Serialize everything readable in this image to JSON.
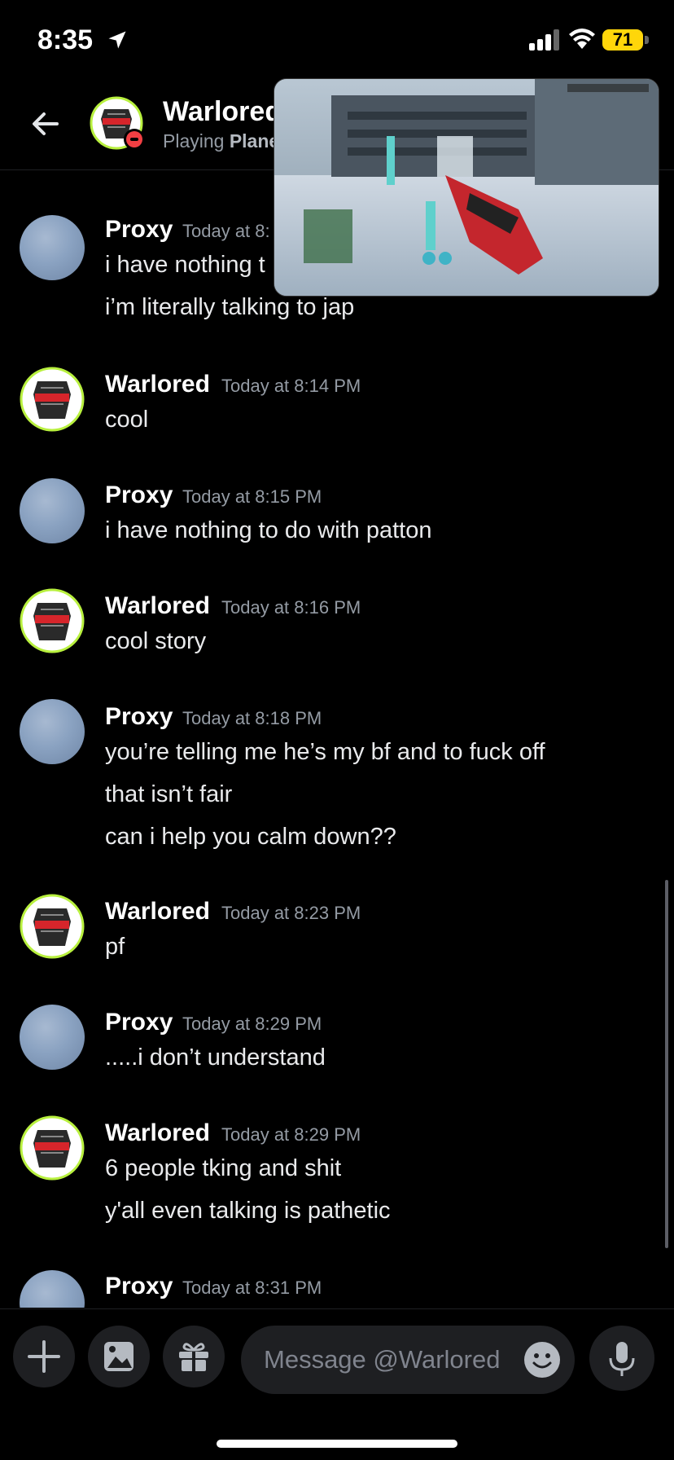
{
  "status_bar": {
    "time": "8:35",
    "battery": "71"
  },
  "header": {
    "name": "Warlored",
    "status_prefix": "Playing",
    "status_game": "Plane"
  },
  "messages": [
    {
      "user": "Proxy",
      "time": "Today at 8:",
      "lines": [
        "i have nothing t",
        "i’m literally talking to jap"
      ]
    },
    {
      "user": "Warlored",
      "time": "Today at 8:14 PM",
      "lines": [
        "cool"
      ]
    },
    {
      "user": "Proxy",
      "time": "Today at 8:15 PM",
      "lines": [
        "i have nothing to do with patton"
      ]
    },
    {
      "user": "Warlored",
      "time": "Today at 8:16 PM",
      "lines": [
        "cool story"
      ]
    },
    {
      "user": "Proxy",
      "time": "Today at 8:18 PM",
      "lines": [
        "you’re telling me he’s my bf and to fuck off",
        "that isn’t fair",
        "can i help you calm down??"
      ]
    },
    {
      "user": "Warlored",
      "time": "Today at 8:23 PM",
      "lines": [
        "pf"
      ]
    },
    {
      "user": "Proxy",
      "time": "Today at 8:29 PM",
      "lines": [
        ".....i don’t understand"
      ]
    },
    {
      "user": "Warlored",
      "time": "Today at 8:29 PM",
      "lines": [
        "6 people tking and shit",
        "y'all even talking is pathetic"
      ]
    },
    {
      "user": "Proxy",
      "time": "Today at 8:31 PM",
      "lines": []
    }
  ],
  "composer": {
    "placeholder": "Message @Warlored"
  },
  "icons": {
    "back": "arrow-left-icon",
    "add": "plus-icon",
    "image": "image-icon",
    "gift": "gift-icon",
    "emoji": "emoji-icon",
    "mic": "microphone-icon"
  }
}
